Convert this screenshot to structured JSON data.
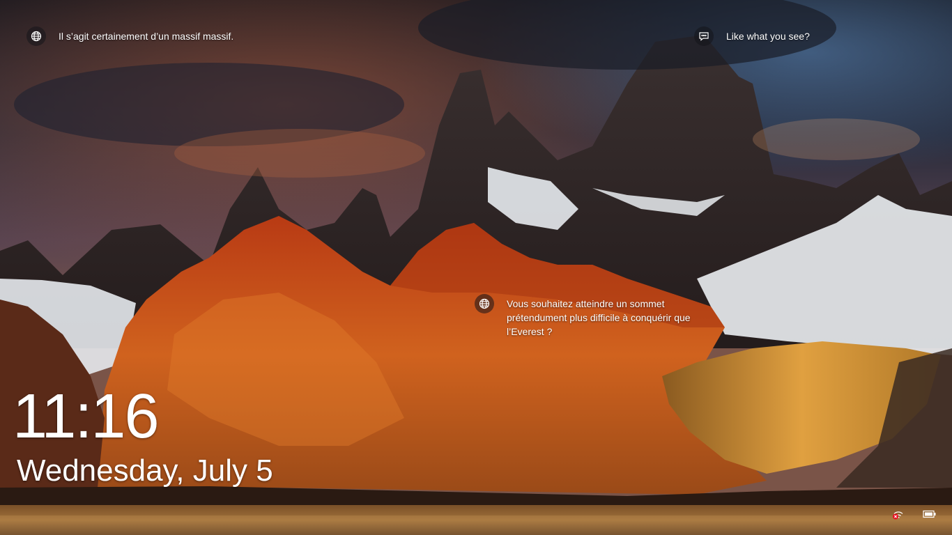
{
  "lockscreen": {
    "spotlight": {
      "top_left_text": "Il s’agit certainement d’un massif massif.",
      "top_right_text": "Like what you see?",
      "middle_text": "Vous souhaitez atteindre un sommet prétendument plus difficile à conquérir que l’Everest ?"
    },
    "time": "11:16",
    "date": "Wednesday, July 5",
    "tray": {
      "network_icon": "network-disconnected-icon",
      "battery_icon": "battery-icon"
    }
  },
  "colors": {
    "text": "#ffffff",
    "sky_dark": "#1b1e2a",
    "mountain_orange": "#c8501e",
    "snow": "#e6e8ec",
    "lake": "#8a5a30",
    "network_error_red": "#e81123"
  }
}
